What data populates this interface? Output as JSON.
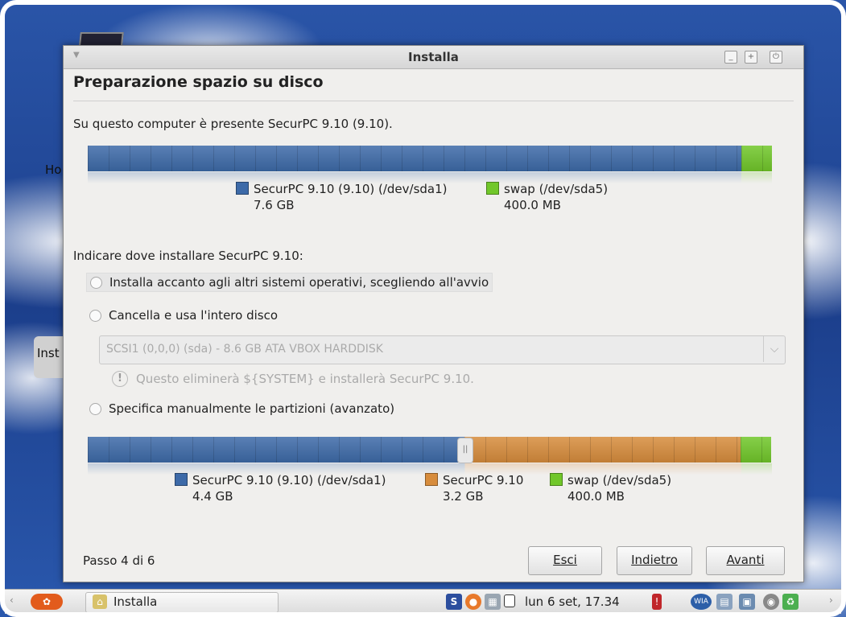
{
  "desktop": {
    "label_ho": "Ho",
    "label_inst": "Inst"
  },
  "window": {
    "title": "Installa",
    "heading": "Preparazione spazio su disco",
    "present_text": "Su questo computer è presente SecurPC 9.10 (9.10).",
    "top_bar": {
      "segments": [
        {
          "name": "SecurPC 9.10 (9.10) (/dev/sda1)",
          "size": "7.6 GB",
          "color": "#3d6aa8",
          "fraction": 0.955
        },
        {
          "name": "swap (/dev/sda5)",
          "size": "400.0 MB",
          "color": "#71c72a",
          "fraction": 0.045
        }
      ]
    },
    "question": "Indicare dove installare SecurPC 9.10:",
    "options": {
      "side_by_side": "Installa accanto agli altri sistemi operativi, scegliendo all'avvio",
      "erase_disk": "Cancella e usa l'intero disco",
      "manual": "Specifica manualmente le partizioni (avanzato)"
    },
    "disk_select": {
      "value": "SCSI1 (0,0,0) (sda) - 8.6 GB ATA VBOX HARDDISK"
    },
    "warning": {
      "icon_text": "!",
      "text": "Questo eliminerà ${SYSTEM} e installerà SecurPC 9.10."
    },
    "bottom_bar": {
      "segments": [
        {
          "name": "SecurPC 9.10 (9.10) (/dev/sda1)",
          "size": "4.4 GB",
          "color": "#3d6aa8",
          "fraction": 0.551
        },
        {
          "name": "SecurPC 9.10",
          "size": "3.2 GB",
          "color": "#d78c3c",
          "fraction": 0.404
        },
        {
          "name": "swap (/dev/sda5)",
          "size": "400.0 MB",
          "color": "#71c72a",
          "fraction": 0.045
        }
      ],
      "handle_glyph": "||"
    },
    "step_text": "Passo 4 di 6",
    "buttons": {
      "quit": "Esci",
      "back": "Indietro",
      "forward": "Avanti"
    }
  },
  "taskbar": {
    "task_label": "Installa",
    "clock": "lun  6 set, 17.34",
    "tray_s": "S",
    "tray_wia": "WIA"
  },
  "colors": {
    "blue": "#3d6aa8",
    "orange": "#d78c3c",
    "green": "#71c72a"
  }
}
